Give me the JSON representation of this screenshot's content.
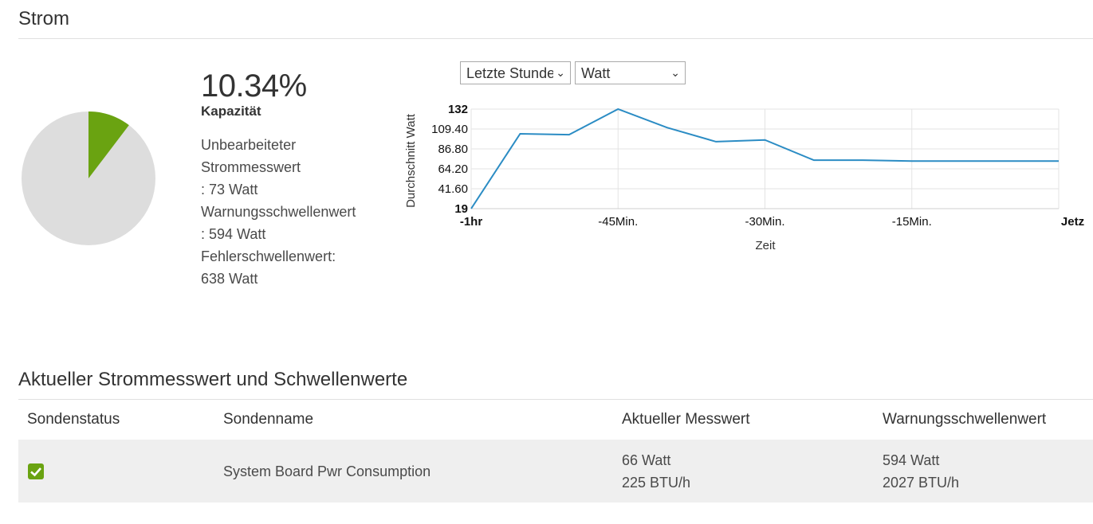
{
  "header": {
    "title": "Strom"
  },
  "capacity": {
    "percent": "10.34%",
    "percent_value": 10.34,
    "label": "Kapazität",
    "raw_reading_label": "Unbearbeiteter",
    "raw_reading_label2": "Strommesswert",
    "raw_reading_value": ": 73 Watt",
    "warning_label": "Warnungsschwellenwert",
    "warning_value": ": 594 Watt",
    "error_label": "Fehlerschwellenwert:",
    "error_value": "638 Watt"
  },
  "controls": {
    "range_select": "Letzte Stunde",
    "unit_select": "Watt"
  },
  "chart_data": {
    "type": "line",
    "ylabel": "Durchschnitt Watt",
    "xlabel": "Zeit",
    "ylim": [
      19,
      132
    ],
    "yticks": [
      "132",
      "109.40",
      "86.80",
      "64.20",
      "41.60",
      "19"
    ],
    "xtick_labels": [
      "-1hr",
      "-45Min.",
      "-30Min.",
      "-15Min.",
      "Jetzt"
    ],
    "x": [
      -60,
      -55,
      -50,
      -45,
      -40,
      -35,
      -30,
      -25,
      -20,
      -15,
      -10,
      -5,
      0
    ],
    "series": [
      {
        "values": [
          19,
          104,
          103,
          132,
          111,
          95,
          97,
          74,
          74,
          73,
          73,
          73,
          73
        ]
      }
    ],
    "line_color": "#2b8cc4"
  },
  "section2": {
    "title": "Aktueller Strommesswert und Schwellenwerte"
  },
  "table": {
    "headers": [
      "Sondenstatus",
      "Sondenname",
      "Aktueller Messwert",
      "Warnungsschwellenwert"
    ],
    "rows": [
      {
        "status": "ok",
        "name": "System Board Pwr Consumption",
        "reading_watt": "66 Watt",
        "reading_btu": "225 BTU/h",
        "warn_watt": "594 Watt",
        "warn_btu": "2027 BTU/h"
      }
    ]
  },
  "colors": {
    "pie_used": "#6aa311",
    "pie_free": "#dddddd",
    "status_ok": "#6aa311"
  }
}
